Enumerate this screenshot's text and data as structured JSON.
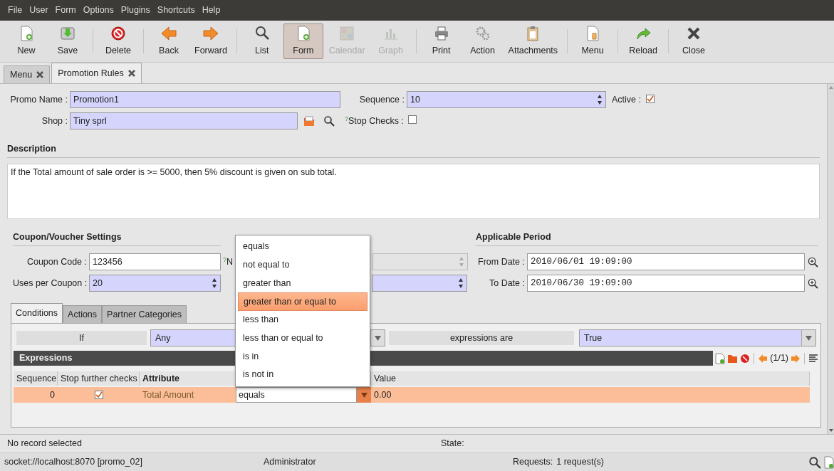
{
  "menu_bar": [
    {
      "label": "File"
    },
    {
      "label": "User"
    },
    {
      "label": "Form"
    },
    {
      "label": "Options"
    },
    {
      "label": "Plugins"
    },
    {
      "label": "Shortcuts"
    },
    {
      "label": "Help"
    }
  ],
  "toolbar": [
    [
      {
        "label": "New",
        "disabled": false,
        "selected": false
      },
      {
        "label": "Save",
        "disabled": false,
        "selected": false
      }
    ],
    [
      {
        "label": "Delete",
        "disabled": false,
        "selected": false
      }
    ],
    [
      {
        "label": "Back",
        "disabled": false,
        "selected": false
      },
      {
        "label": "Forward",
        "disabled": false,
        "selected": false
      }
    ],
    [
      {
        "label": "List",
        "disabled": false,
        "selected": false
      },
      {
        "label": "Form",
        "disabled": false,
        "selected": true
      },
      {
        "label": "Calendar",
        "disabled": true,
        "selected": false
      },
      {
        "label": "Graph",
        "disabled": true,
        "selected": false
      }
    ],
    [
      {
        "label": "Print",
        "disabled": false,
        "selected": false
      },
      {
        "label": "Action",
        "disabled": false,
        "selected": false
      },
      {
        "label": "Attachments",
        "disabled": false,
        "selected": false
      }
    ],
    [
      {
        "label": "Menu",
        "disabled": false,
        "selected": false
      }
    ],
    [
      {
        "label": "Reload",
        "disabled": false,
        "selected": false
      }
    ],
    [
      {
        "label": "Close",
        "disabled": false,
        "selected": false
      }
    ]
  ],
  "tabs": [
    {
      "label": "Menu",
      "selected": false
    },
    {
      "label": "Promotion Rules",
      "selected": true
    }
  ],
  "form": {
    "promo_name": {
      "label": "Promo Name :",
      "value": "Promotion1",
      "required": true
    },
    "sequence": {
      "label": "Sequence :",
      "value": "10",
      "required": true
    },
    "active": {
      "label": "Active :",
      "checked": true
    },
    "shop": {
      "label": "Shop :",
      "value": "Tiny sprl",
      "required": true
    },
    "stop_checks": {
      "help_mark": "?",
      "label": "Stop Checks :",
      "checked": false
    },
    "description": {
      "heading": "Description",
      "text": "If the Total amount of sale order is >= 5000, then 5% discount is given on sub total."
    }
  },
  "coupon_settings": {
    "heading": "Coupon/Voucher Settings",
    "coupon_code": {
      "label": "Coupon Code :",
      "value": "123456",
      "required": false
    },
    "uses_per_coupon": {
      "label": "Uses per Coupon :",
      "value": "20",
      "required": true
    }
  },
  "middle_column": {
    "label": {
      "help_mark": "?",
      "text": "N"
    },
    "fields": [
      {
        "disabled": true,
        "required": false
      },
      {
        "disabled": false,
        "required": true
      }
    ]
  },
  "applicable_period": {
    "heading": "Applicable Period",
    "from_date": {
      "label": "From Date :",
      "value": "2010/06/01 19:09:00"
    },
    "to_date": {
      "label": "To Date :",
      "value": "2010/06/30 19:09:00"
    }
  },
  "notebook": {
    "tabs": [
      {
        "label": "Conditions",
        "selected": true
      },
      {
        "label": "Actions",
        "selected": false
      },
      {
        "label": "Partner Categories",
        "selected": false
      }
    ],
    "conditions": {
      "if_label": "If",
      "match": "Any",
      "expressions_label": "expressions are",
      "result": "True"
    },
    "expressions": {
      "title": "Expressions",
      "pager": "(1/1)",
      "columns": [
        {
          "label": "Sequence",
          "required": false
        },
        {
          "label": "Stop further checks",
          "required": false
        },
        {
          "label": "Attribute",
          "required": true
        },
        {
          "label": "Value",
          "required": false
        }
      ],
      "rows": [
        {
          "sequence": "0",
          "stop_further_checks": true,
          "attribute": "Total Amount",
          "comparator": "equals",
          "value": "0.00",
          "selected": true
        }
      ]
    }
  },
  "dropdown": {
    "options": [
      {
        "label": "equals",
        "selected": false
      },
      {
        "label": "not equal to",
        "selected": false
      },
      {
        "label": "greater than",
        "selected": false
      },
      {
        "label": "greater than or equal to",
        "selected": true
      },
      {
        "label": "less than",
        "selected": false
      },
      {
        "label": "less than or equal to",
        "selected": false
      },
      {
        "label": "is in",
        "selected": false
      },
      {
        "label": "is not in",
        "selected": false
      }
    ]
  },
  "status": {
    "message": "No record selected",
    "state_label": "State:"
  },
  "footer": {
    "connection": "socket://localhost:8070 [promo_02]",
    "user": "Administrator",
    "requests_label": "Requests:",
    "requests_value": "1 request(s)"
  }
}
